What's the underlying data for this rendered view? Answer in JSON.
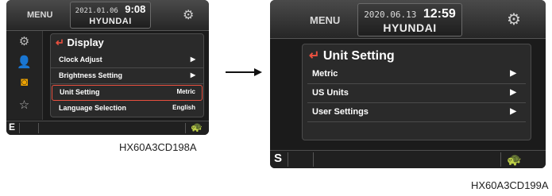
{
  "screen_a": {
    "menu_label": "MENU",
    "date": "2021.01.06",
    "time": "9:08",
    "brand": "HYUNDAI",
    "title": "Display",
    "items": [
      {
        "label": "Clock Adjust",
        "value": "▶"
      },
      {
        "label": "Brightness Setting",
        "value": "▶"
      },
      {
        "label": "Unit Setting",
        "value": "Metric"
      },
      {
        "label": "Language Selection",
        "value": "English"
      }
    ],
    "selected_index": 2,
    "mode_letter": "E",
    "caption": "HX60A3CD198A"
  },
  "screen_b": {
    "menu_label": "MENU",
    "date": "2020.06.13",
    "time": "12:59",
    "brand": "HYUNDAI",
    "title": "Unit Setting",
    "items": [
      {
        "label": "Metric",
        "value": "▶"
      },
      {
        "label": "US Units",
        "value": "▶"
      },
      {
        "label": "User Settings",
        "value": "▶"
      }
    ],
    "mode_letter": "S",
    "caption": "HX60A3CD199A"
  },
  "icons": {
    "sidebar": [
      "gear-icon",
      "person-icon",
      "clock-monitor-icon",
      "star-icon"
    ],
    "turtle": "turtle-icon",
    "settings": "cog-icon"
  },
  "colors": {
    "accent": "#e9503f",
    "turtle_green": "#2bc24a",
    "active_icon": "#f0a400"
  }
}
